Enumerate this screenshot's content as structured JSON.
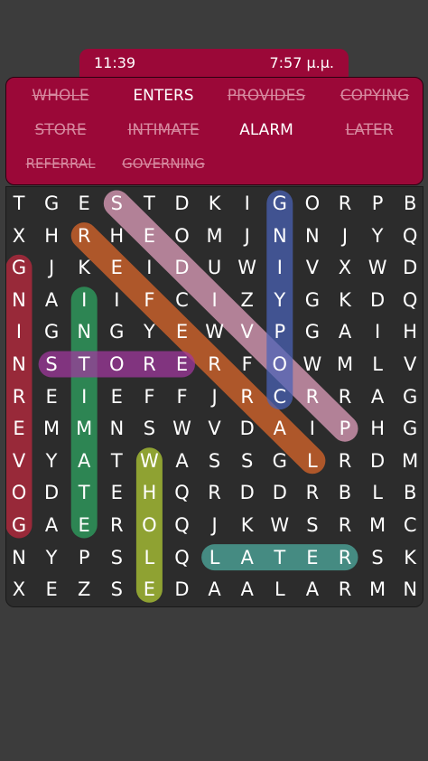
{
  "status_bar": {
    "left_time": "11:39",
    "right_time": "7:57 μ.μ."
  },
  "words": [
    {
      "text": "WHOLE",
      "found": true
    },
    {
      "text": "ENTERS",
      "found": false
    },
    {
      "text": "PROVIDES",
      "found": true
    },
    {
      "text": "COPYING",
      "found": true
    },
    {
      "text": "STORE",
      "found": true
    },
    {
      "text": "INTIMATE",
      "found": true
    },
    {
      "text": "ALARM",
      "found": false
    },
    {
      "text": "LATER",
      "found": true
    },
    {
      "text": "REFERRAL",
      "found": true
    },
    {
      "text": "GOVERNING",
      "found": true
    }
  ],
  "grid": [
    [
      "T",
      "G",
      "E",
      "S",
      "T",
      "D",
      "K",
      "I",
      "G",
      "O",
      "R",
      "P",
      "B"
    ],
    [
      "X",
      "H",
      "R",
      "H",
      "E",
      "O",
      "M",
      "J",
      "N",
      "N",
      "J",
      "Y",
      "Q"
    ],
    [
      "G",
      "J",
      "K",
      "E",
      "I",
      "D",
      "U",
      "W",
      "I",
      "V",
      "X",
      "W",
      "D"
    ],
    [
      "N",
      "A",
      "I",
      "I",
      "F",
      "C",
      "I",
      "Z",
      "Y",
      "G",
      "K",
      "D",
      "Q"
    ],
    [
      "I",
      "G",
      "N",
      "G",
      "Y",
      "E",
      "W",
      "V",
      "P",
      "G",
      "A",
      "I",
      "H"
    ],
    [
      "N",
      "S",
      "T",
      "O",
      "R",
      "E",
      "R",
      "F",
      "O",
      "W",
      "M",
      "L",
      "V"
    ],
    [
      "R",
      "E",
      "I",
      "E",
      "F",
      "F",
      "J",
      "R",
      "C",
      "R",
      "R",
      "A",
      "G"
    ],
    [
      "E",
      "M",
      "M",
      "N",
      "S",
      "W",
      "V",
      "D",
      "A",
      "I",
      "P",
      "H",
      "G"
    ],
    [
      "V",
      "Y",
      "A",
      "T",
      "W",
      "A",
      "S",
      "S",
      "G",
      "L",
      "R",
      "D",
      "M"
    ],
    [
      "O",
      "D",
      "T",
      "E",
      "H",
      "Q",
      "R",
      "D",
      "D",
      "R",
      "B",
      "L",
      "B"
    ],
    [
      "G",
      "A",
      "E",
      "R",
      "O",
      "Q",
      "J",
      "K",
      "W",
      "S",
      "R",
      "M",
      "C"
    ],
    [
      "N",
      "Y",
      "P",
      "S",
      "L",
      "Q",
      "L",
      "A",
      "T",
      "E",
      "R",
      "S",
      "K"
    ],
    [
      "X",
      "E",
      "Z",
      "S",
      "E",
      "D",
      "A",
      "A",
      "L",
      "A",
      "R",
      "M",
      "N"
    ]
  ],
  "highlights": [
    {
      "word": "PROVIDES",
      "color": "#e6a2c0",
      "from": [
        3,
        0
      ],
      "to": [
        10,
        7
      ]
    },
    {
      "word": "REFERRAL",
      "color": "#e0682a",
      "from": [
        2,
        1
      ],
      "to": [
        9,
        8
      ]
    },
    {
      "word": "COPYING",
      "color": "#4a62b8",
      "from": [
        8,
        0
      ],
      "to": [
        8,
        6
      ]
    },
    {
      "word": "GOVERNING",
      "color": "#c2283e",
      "from": [
        0,
        2
      ],
      "to": [
        0,
        10
      ]
    },
    {
      "word": "INTIMATE",
      "color": "#2ea862",
      "from": [
        2,
        3
      ],
      "to": [
        2,
        10
      ]
    },
    {
      "word": "STORE",
      "color": "#a238a0",
      "from": [
        1,
        5
      ],
      "to": [
        5,
        5
      ]
    },
    {
      "word": "WHOLE",
      "color": "#b6d034",
      "from": [
        4,
        8
      ],
      "to": [
        4,
        12
      ]
    },
    {
      "word": "LATER",
      "color": "#4fb0a4",
      "from": [
        6,
        11
      ],
      "to": [
        10,
        11
      ]
    }
  ]
}
